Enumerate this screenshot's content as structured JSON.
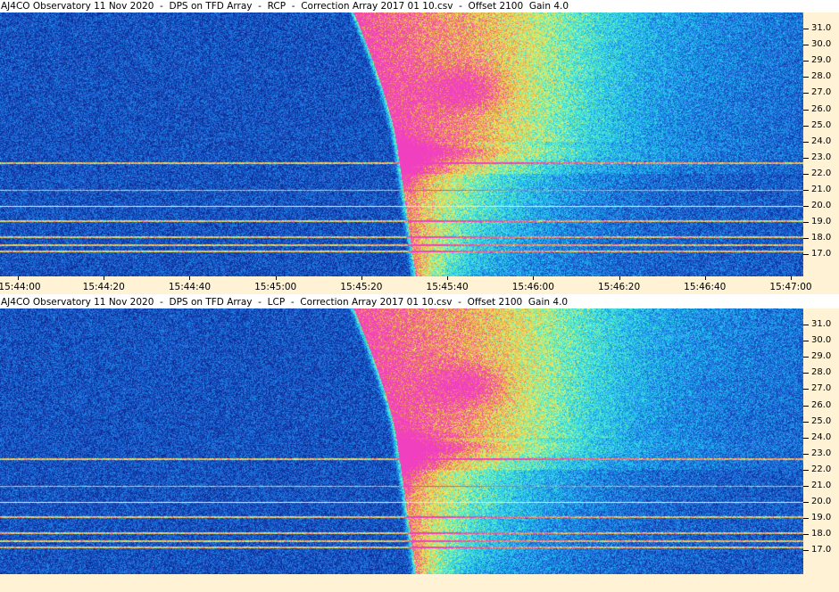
{
  "panels": [
    {
      "title": "AJ4CO Observatory 11 Nov 2020  -  DPS on TFD Array  -  RCP  -  Correction Array 2017 01 10.csv  -  Offset 2100  Gain 4.0",
      "polarization": "RCP"
    },
    {
      "title": "AJ4CO Observatory 11 Nov 2020  -  DPS on TFD Array  -  LCP  -  Correction Array 2017 01 10.csv  -  Offset 2100  Gain 4.0",
      "polarization": "LCP"
    }
  ],
  "frequency_axis": {
    "labels": [
      "31.0",
      "30.0",
      "29.0",
      "28.0",
      "27.0",
      "26.0",
      "25.0",
      "24.0",
      "23.0",
      "22.0",
      "21.0",
      "20.0",
      "19.0",
      "18.0",
      "17.0"
    ]
  },
  "time_axis": {
    "labels": [
      "15:44:00",
      "15:44:20",
      "15:44:40",
      "15:45:00",
      "15:45:20",
      "15:45:40",
      "15:46:00",
      "15:46:20",
      "15:46:40",
      "15:47:00"
    ]
  },
  "colors": {
    "background": "#08124a",
    "axis_background": "#fff2d5",
    "colormap": [
      "#08124a",
      "#1030a0",
      "#1e6fe0",
      "#20c8f0",
      "#60f0c0",
      "#f0f060",
      "#f0b040",
      "#f06090",
      "#f040c0"
    ]
  }
}
